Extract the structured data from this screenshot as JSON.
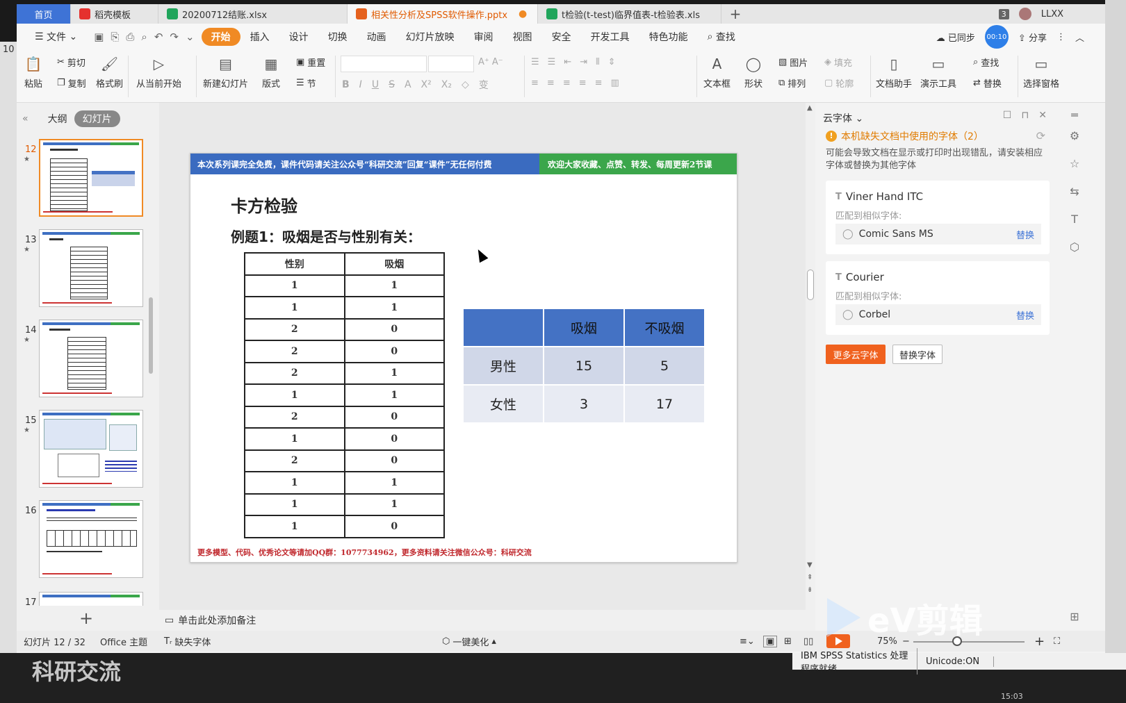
{
  "tabs": {
    "home": "首页",
    "items": [
      {
        "label": "稻壳模板",
        "color": "#e5312e"
      },
      {
        "label": "20200712结账.xlsx",
        "color": "#20a55b"
      },
      {
        "label": "相关性分析及SPSS软件操作.pptx",
        "color": "#e5611e"
      },
      {
        "label": "t检验(t-test)临界值表-t检验表.xls",
        "color": "#20a55b"
      }
    ],
    "count": "3",
    "user": "LLXX"
  },
  "menubar": {
    "file": "文件",
    "items": [
      "开始",
      "插入",
      "设计",
      "切换",
      "动画",
      "幻灯片放映",
      "审阅",
      "视图",
      "安全",
      "开发工具",
      "特色功能"
    ],
    "search": "查找",
    "synced": "已同步",
    "timer": "00:10",
    "share": "分享"
  },
  "ribbon": {
    "paste": "粘贴",
    "cut": "剪切",
    "copy": "复制",
    "format_painter": "格式刷",
    "from_current": "从当前开始",
    "new_slide": "新建幻灯片",
    "layout": "版式",
    "reset": "重置",
    "section": "节",
    "textbox": "文本框",
    "shape": "形状",
    "picture": "图片",
    "arrange": "排列",
    "fill": "填充",
    "outline": "轮廓",
    "find": "查找",
    "replace": "替换",
    "doc_helper": "文档助手",
    "present_tools": "演示工具",
    "select_pane": "选择窗格"
  },
  "leftpane": {
    "outline": "大纲",
    "slides": "幻灯片",
    "thumbs": [
      "12",
      "13",
      "14",
      "15",
      "16",
      "17"
    ]
  },
  "slide": {
    "banner_left": "本次系列课完全免费，课件代码请关注公众号“科研交流”回复“课件”无任何付费",
    "banner_right": "欢迎大家收藏、点赞、转发、每周更新2节课",
    "title": "卡方检验",
    "subtitle": "例题1：吸烟是否与性别有关：",
    "data_table": {
      "headers": [
        "性别",
        "吸烟"
      ],
      "rows": [
        [
          "1",
          "1"
        ],
        [
          "1",
          "1"
        ],
        [
          "2",
          "0"
        ],
        [
          "2",
          "0"
        ],
        [
          "2",
          "1"
        ],
        [
          "1",
          "1"
        ],
        [
          "2",
          "0"
        ],
        [
          "1",
          "0"
        ],
        [
          "2",
          "0"
        ],
        [
          "1",
          "1"
        ],
        [
          "1",
          "1"
        ],
        [
          "1",
          "0"
        ]
      ]
    },
    "cross_table": {
      "headers": [
        "",
        "吸烟",
        "不吸烟"
      ],
      "rows": [
        [
          "男性",
          "15",
          "5"
        ],
        [
          "女性",
          "3",
          "17"
        ]
      ]
    },
    "footer": "更多模型、代码、优秀论文等请加QQ群：1077734962，更多资料请关注微信公众号：科研交流"
  },
  "notes": "单击此处添加备注",
  "rightpanel": {
    "title": "云字体",
    "warning": "本机缺失文档中使用的字体（2）",
    "desc": "可能会导致文档在显示或打印时出现错乱，请安装相应字体或替换为其他字体",
    "fonts": [
      {
        "name": "Viner Hand ITC",
        "label": "匹配到相似字体:",
        "match": "Comic Sans MS",
        "replace": "替换"
      },
      {
        "name": "Courier",
        "label": "匹配到相似字体:",
        "match": "Corbel",
        "replace": "替换"
      }
    ],
    "more": "更多云字体",
    "swap": "替换字体"
  },
  "statusbar": {
    "slide_info": "幻灯片 12 / 32",
    "theme": "Office 主题",
    "missing_font": "缺失字体",
    "beautify": "一键美化",
    "zoom": "75%"
  },
  "watermark": "eV剪辑",
  "taskbar": {
    "overlay": "科研交流",
    "spss_status": "IBM SPSS Statistics 处理程序就绪",
    "unicode": "Unicode:ON",
    "time": "15:03"
  },
  "left_edge": "10"
}
